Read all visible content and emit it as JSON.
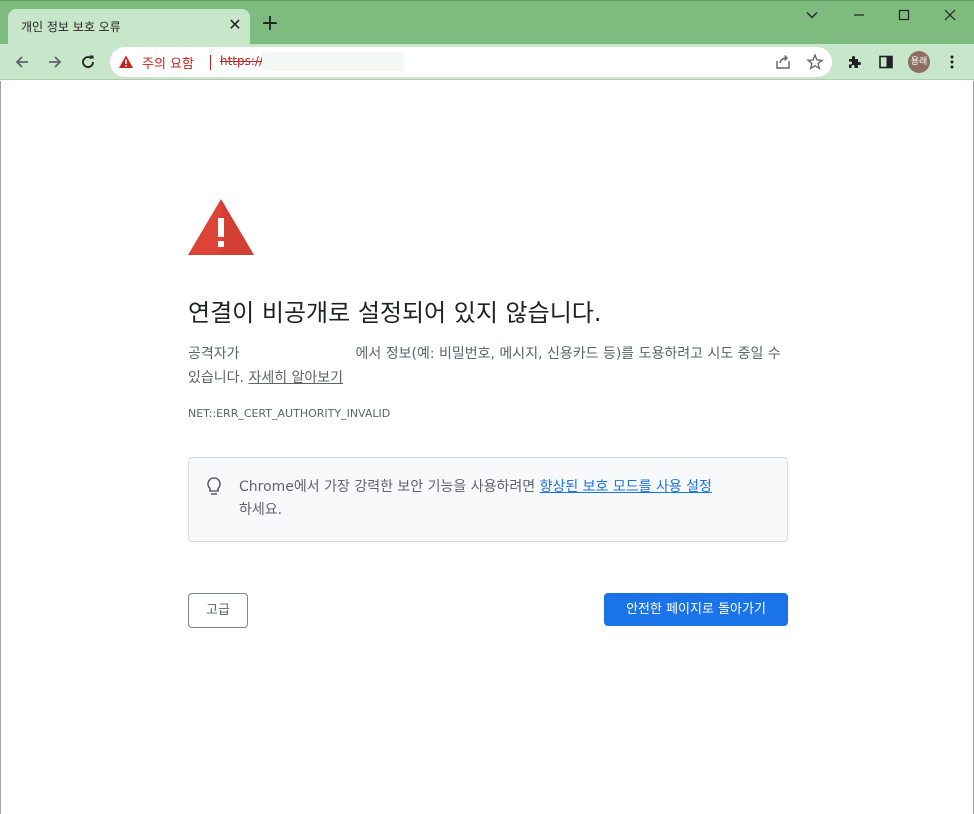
{
  "tab": {
    "title": "개인 정보 보호 오류",
    "close": "✕",
    "new_tab": "+"
  },
  "omnibox": {
    "security_label": "주의 요함",
    "url": "https://"
  },
  "profile": {
    "avatar_text": "용래",
    "color": "#8d6e63"
  },
  "main": {
    "heading": "연결이 비공개로 설정되어 있지 않습니다.",
    "description_prefix": "공격자가",
    "description_middle": "에서 정보(예: 비밀번호, 메시지, 신용카드 등)를 도용하려고 시도 중일 수 있습니다.",
    "learn_more_link": "자세히 알아보기",
    "error_code": "NET::ERR_CERT_AUTHORITY_INVALID"
  },
  "info": {
    "text_prefix": "Chrome에서 가장 강력한 보안 기능을 사용하려면",
    "link": "향상된 보호 모드를 사용 설정",
    "text_suffix": "하세요."
  },
  "buttons": {
    "advanced": "고급",
    "back_to_safety": "안전한 페이지로 돌아가기"
  },
  "colors": {
    "frame": "#7dbc7e",
    "toolbar": "#c8e6c9",
    "danger": "#c5221f",
    "error_icon": "#db4437",
    "primary": "#1a73e8"
  }
}
